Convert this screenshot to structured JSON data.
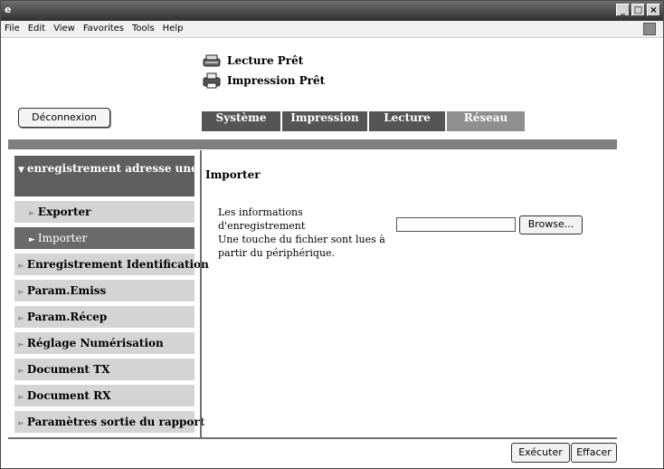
{
  "browser": {
    "menu": [
      "File",
      "Edit",
      "View",
      "Favorites",
      "Tools",
      "Help"
    ],
    "window_controls": [
      "minimize-icon",
      "maximize-icon",
      "close-icon"
    ]
  },
  "status": {
    "scan": "Lecture Prêt",
    "print": "Impression Prêt"
  },
  "logout_label": "Déconnexion",
  "tabs": [
    {
      "label": "Système",
      "state": "active"
    },
    {
      "label": "Impression",
      "state": "active"
    },
    {
      "label": "Lecture",
      "state": "active"
    },
    {
      "label": "Réseau",
      "state": "inactive"
    }
  ],
  "sidebar": {
    "group": "enregistrement adresse une-touche",
    "sub": [
      {
        "label": "Exporter",
        "active": false
      },
      {
        "label": "Importer",
        "active": true
      }
    ],
    "items": [
      "Enregistrement Identification",
      "Param.Emiss",
      "Param.Récep",
      "Réglage Numérisation",
      "Document TX",
      "Document RX",
      "Paramètres sortie du rapport"
    ]
  },
  "main": {
    "title": "Importer",
    "desc": [
      "Les informations d'enregistrement",
      "Une touche du fichier sont lues à",
      "partir du périphérique."
    ],
    "file_value": "",
    "browse_label": "Browse..."
  },
  "footer": {
    "execute": "Exécuter",
    "clear": "Effacer"
  },
  "colors": {
    "tab_bg": "#555555",
    "tab_inactive_bg": "#8f8f8f",
    "sidebar_bg": "#d4d4d4",
    "sidebar_active_bg": "#6a6a6a",
    "bar": "#7f7f7f"
  }
}
